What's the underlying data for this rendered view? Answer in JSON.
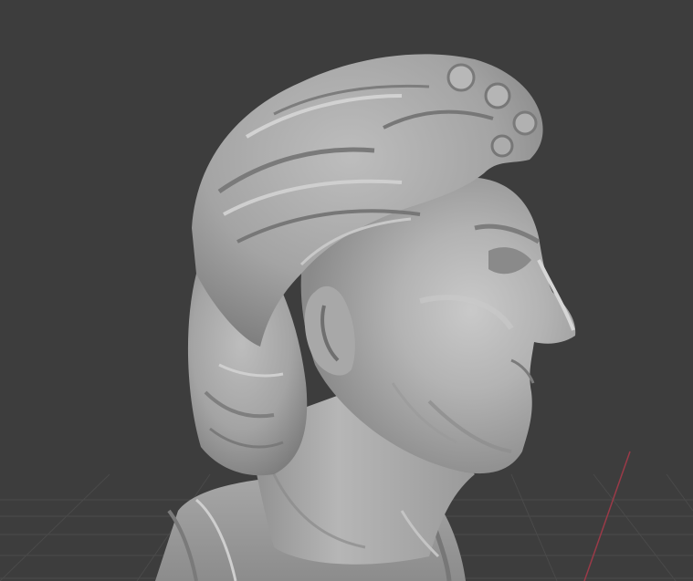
{
  "viewport": {
    "background_color": "#3d3d3d",
    "grid_line_color": "#4a4a4a",
    "x_axis_color": "#9a3a48",
    "mesh_base_color": "#a9a9a9",
    "mesh_shadow_color": "#6e6e6e",
    "mesh_highlight_color": "#d8d8d8",
    "shading_mode": "solid",
    "object": "sculpted-head-bust"
  }
}
